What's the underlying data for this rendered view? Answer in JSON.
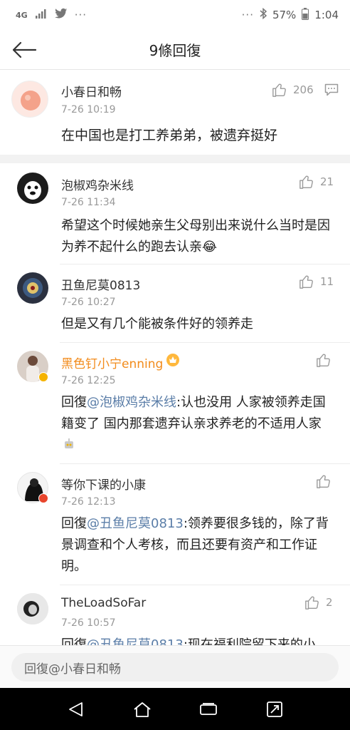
{
  "status_bar": {
    "network": "4G",
    "dots": "···",
    "dots_right": "···",
    "battery": "57%",
    "time": "1:04"
  },
  "header": {
    "title": "9條回復"
  },
  "main_comment": {
    "user": "小春日和畅",
    "time": "7-26 10:19",
    "likes": "206",
    "text": "在中国也是打工养弟弟，被遗弃挺好"
  },
  "replies": [
    {
      "user": "泡椒鸡杂米线",
      "time": "7-26 11:34",
      "likes": "21",
      "text": "希望这个时候她亲生父母别出来说什么当时是因为养不起什么的跑去认亲😂"
    },
    {
      "user": "丑鱼尼莫0813",
      "time": "7-26 10:27",
      "likes": "11",
      "text": "但是又有几个能被条件好的领养走"
    },
    {
      "user": "黑色钉小宁enning",
      "time": "7-26 12:25",
      "likes": "",
      "prefix": "回復",
      "mention": "@泡椒鸡杂米线",
      "text": ":认也没用 人家被领养走国籍变了 国内那套遗弃认亲求养老的不适用人家"
    },
    {
      "user": "等你下课的小康",
      "time": "7-26 12:13",
      "likes": "",
      "prefix": "回復",
      "mention": "@丑鱼尼莫0813",
      "text": ":领养要很多钱的，除了背景调查和个人考核，而且还要有资产和工作证明。"
    },
    {
      "user": "TheLoadSoFar",
      "time": "7-26 10:57",
      "likes": "2",
      "prefix": "回復",
      "mention": "@丑鱼尼莫0813",
      "text": ":现在福利院留下来的小"
    }
  ],
  "reply_bar": {
    "placeholder": "回復@小春日和畅"
  },
  "colors": {
    "mention": "#5b7ea8",
    "vip_name": "#f28b1b",
    "meta": "#999999"
  }
}
